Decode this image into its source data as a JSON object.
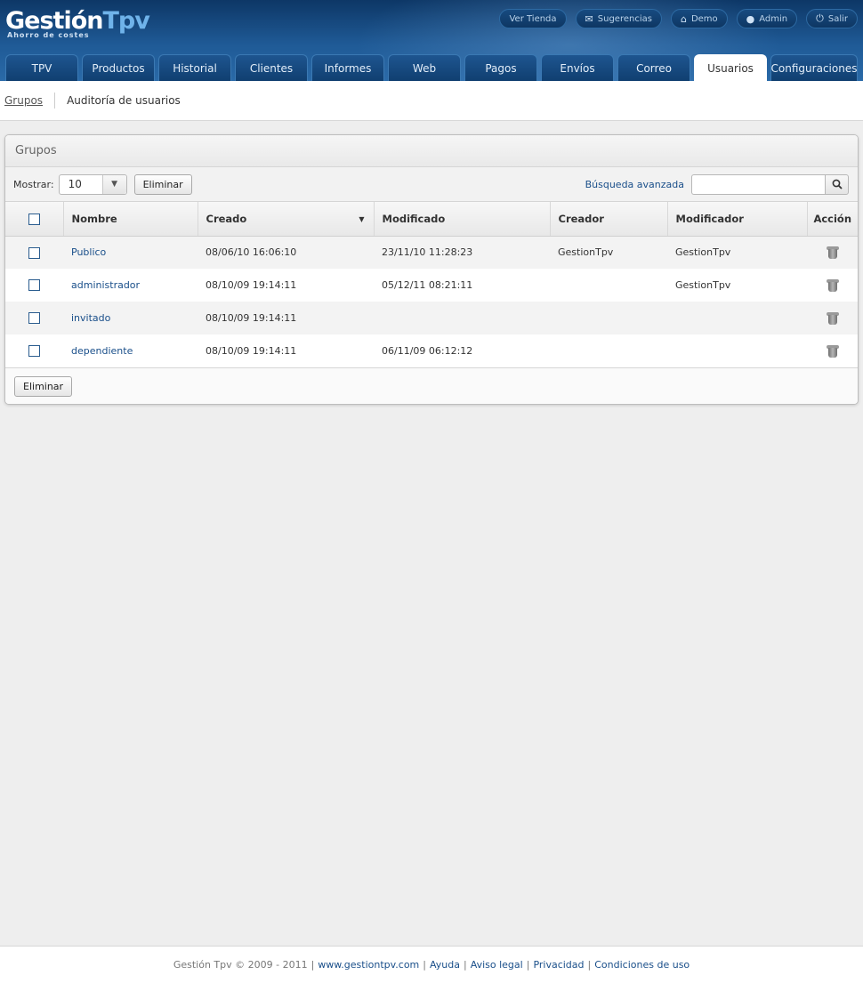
{
  "logo": {
    "part1": "Gestión",
    "part2": "Tpv",
    "tagline": "Ahorro de costes"
  },
  "topnav": [
    {
      "label": "Ver Tienda",
      "icon": ""
    },
    {
      "label": "Sugerencias",
      "icon": "mail-icon"
    },
    {
      "label": "Demo",
      "icon": "home-icon"
    },
    {
      "label": "Admin",
      "icon": "user-icon"
    },
    {
      "label": "Salir",
      "icon": "power-icon"
    }
  ],
  "tabs": [
    "TPV",
    "Productos",
    "Historial",
    "Clientes",
    "Informes",
    "Web",
    "Pagos",
    "Envíos",
    "Correo",
    "Usuarios",
    "Configuraciones"
  ],
  "active_tab": "Usuarios",
  "subnav": {
    "groups_link": "Grupos",
    "audit_link": "Auditoría de usuarios"
  },
  "panel": {
    "title": "Grupos",
    "show_label": "Mostrar:",
    "show_value": "10",
    "delete_label": "Eliminar",
    "advanced_search": "Búsqueda avanzada",
    "search_value": ""
  },
  "table": {
    "columns": [
      "Nombre",
      "Creado",
      "Modificado",
      "Creador",
      "Modificador",
      "Acción"
    ],
    "rows": [
      {
        "name": "Publico",
        "created": "08/06/10 16:06:10",
        "modified": "23/11/10 11:28:23",
        "creator": "GestionTpv",
        "modifier": "GestionTpv"
      },
      {
        "name": "administrador",
        "created": "08/10/09 19:14:11",
        "modified": "05/12/11 08:21:11",
        "creator": "",
        "modifier": "GestionTpv"
      },
      {
        "name": "invitado",
        "created": "08/10/09 19:14:11",
        "modified": "",
        "creator": "",
        "modifier": ""
      },
      {
        "name": "dependiente",
        "created": "08/10/09 19:14:11",
        "modified": "06/11/09 06:12:12",
        "creator": "",
        "modifier": ""
      }
    ]
  },
  "footer": {
    "copyright": "Gestión Tpv © 2009 - 2011",
    "links": [
      "www.gestiontpv.com",
      "Ayuda",
      "Aviso legal",
      "Privacidad",
      "Condiciones de uso"
    ]
  }
}
